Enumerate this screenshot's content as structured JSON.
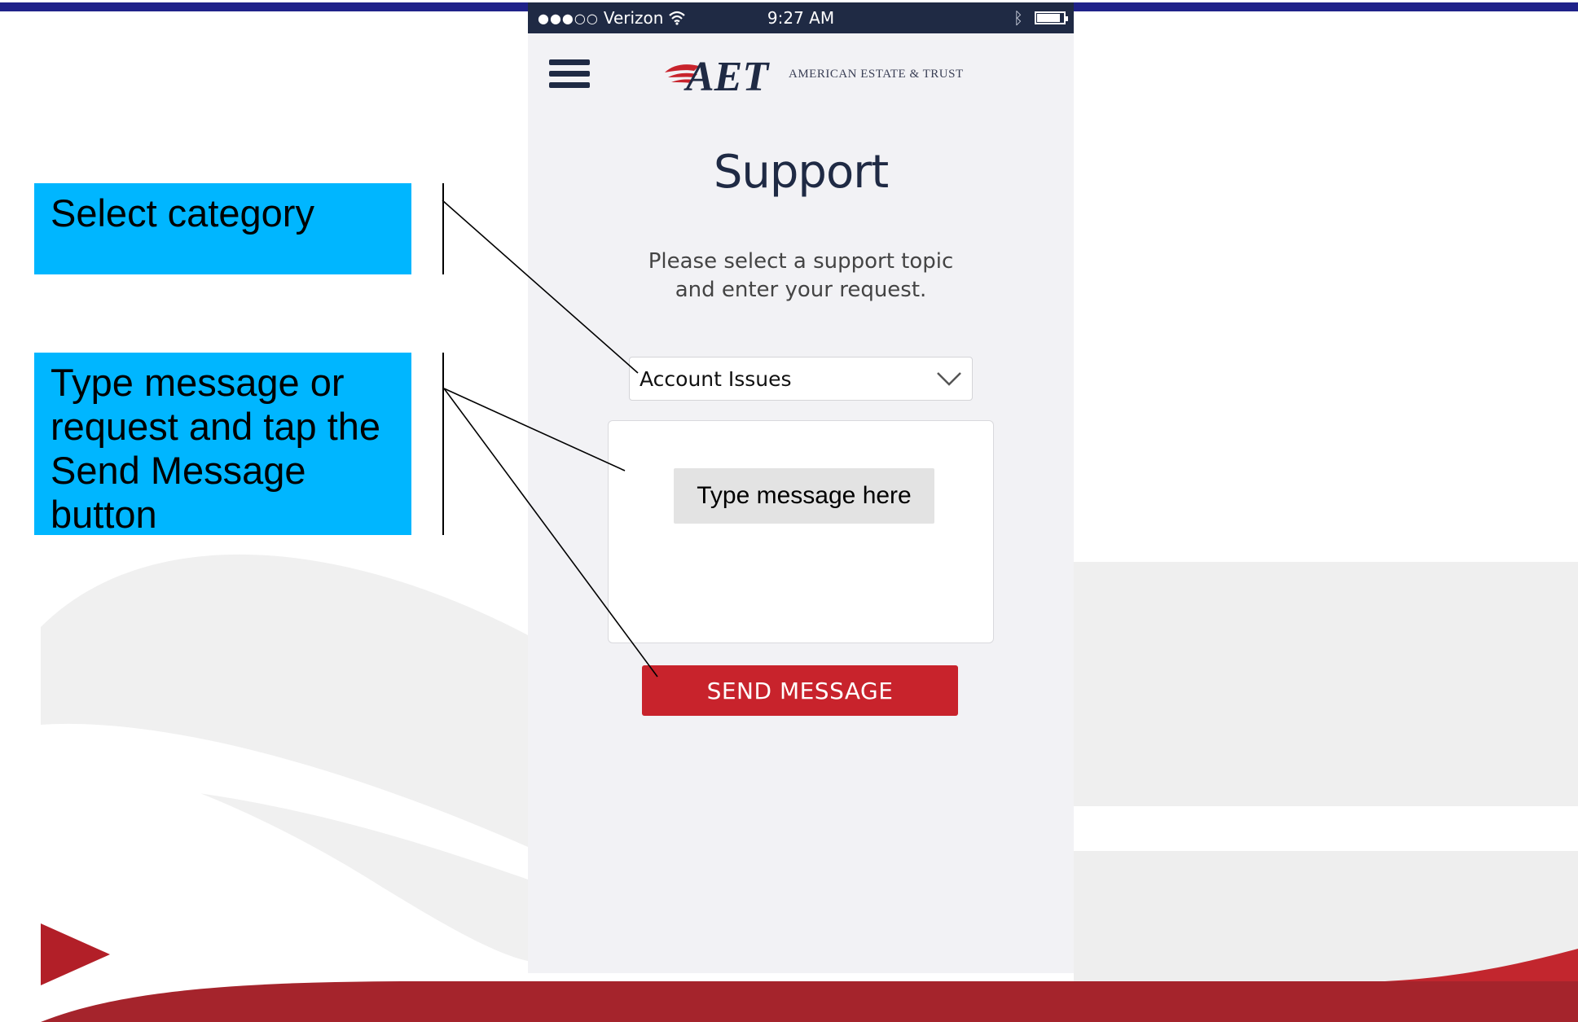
{
  "callouts": [
    {
      "text": "Select category"
    },
    {
      "text": "Type message or request and tap the Send Message button"
    }
  ],
  "status_bar": {
    "signal": "●●●○○",
    "carrier": "Verizon",
    "time": "9:27 AM",
    "bluetooth_icon": "bluetooth-icon",
    "battery_icon": "battery-icon"
  },
  "header": {
    "menu_icon": "hamburger-menu-icon",
    "logo_mark": "AET",
    "logo_text": "AMERICAN ESTATE & TRUST"
  },
  "support": {
    "title": "Support",
    "instruction_line1": "Please select a support topic",
    "instruction_line2": "and enter your request.",
    "category_selected": "Account Issues",
    "message_placeholder": "Type message here",
    "send_label": "SEND MESSAGE"
  },
  "colors": {
    "navy": "#1f2a44",
    "callout_blue": "#00b6ff",
    "brand_red": "#c8232c",
    "top_rule": "#1f2289"
  }
}
